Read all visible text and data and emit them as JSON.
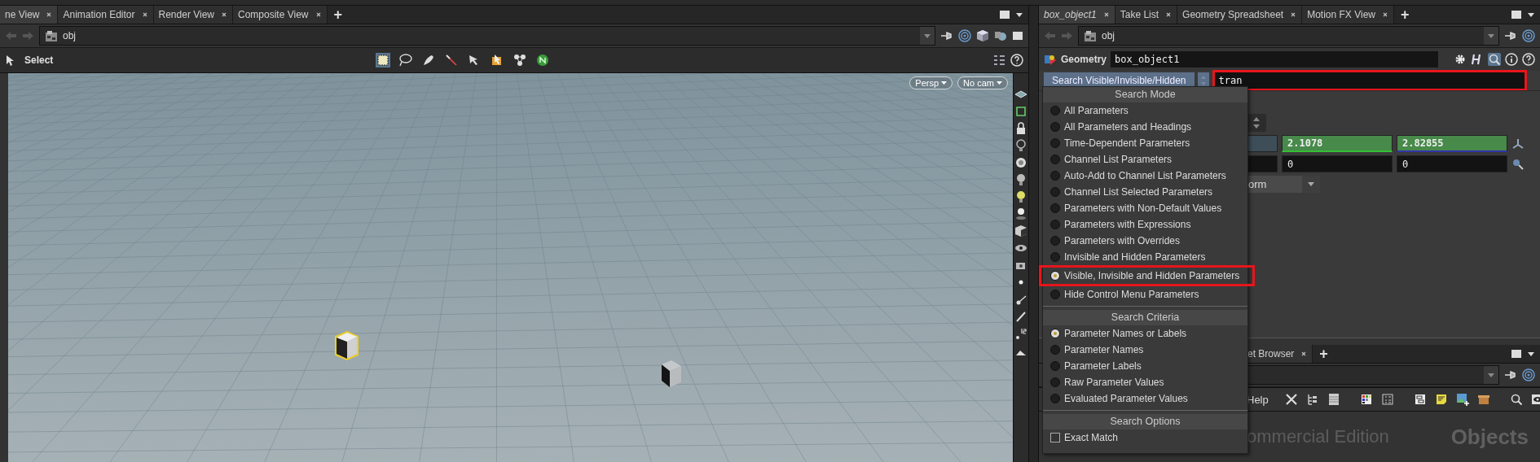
{
  "viewer": {
    "tabs": [
      {
        "label": "ne View",
        "selected": true
      },
      {
        "label": "Animation Editor",
        "selected": false
      },
      {
        "label": "Render View",
        "selected": false
      },
      {
        "label": "Composite View",
        "selected": false
      }
    ],
    "add_tab": "+",
    "path": "obj",
    "tool_label": "Select",
    "camera_buttons": [
      "Persp",
      "No cam"
    ]
  },
  "parameters": {
    "tabs": [
      {
        "label": "box_object1",
        "selected": true
      },
      {
        "label": "Take List",
        "selected": false
      },
      {
        "label": "Geometry Spreadsheet",
        "selected": false
      },
      {
        "label": "Motion FX View",
        "selected": false
      }
    ],
    "add_tab": "+",
    "path": "obj",
    "node_type": "Geometry",
    "node_name": "box_object1",
    "search_mode_button": "Search Visible/Invisible/Hidden",
    "search_field": {
      "value": "tran",
      "highlighted": true
    },
    "field_rows": [
      [
        "2.1078",
        "2.82855"
      ],
      [
        "0",
        "0"
      ]
    ],
    "dropdown": "orm"
  },
  "search_menu": {
    "sections": [
      {
        "title": "Search Mode",
        "kind": "radio",
        "items": [
          {
            "label": "All Parameters",
            "selected": false,
            "highlighted": false
          },
          {
            "label": "All Parameters and Headings",
            "selected": false,
            "highlighted": false
          },
          {
            "label": "Time-Dependent Parameters",
            "selected": false,
            "highlighted": false
          },
          {
            "label": "Channel List Parameters",
            "selected": false,
            "highlighted": false
          },
          {
            "label": "Auto-Add to Channel List Parameters",
            "selected": false,
            "highlighted": false
          },
          {
            "label": "Channel List Selected Parameters",
            "selected": false,
            "highlighted": false
          },
          {
            "label": "Parameters with Non-Default Values",
            "selected": false,
            "highlighted": false
          },
          {
            "label": "Parameters with Expressions",
            "selected": false,
            "highlighted": false
          },
          {
            "label": "Parameters with Overrides",
            "selected": false,
            "highlighted": false
          },
          {
            "label": "Invisible and Hidden Parameters",
            "selected": false,
            "highlighted": false
          },
          {
            "label": "Visible, Invisible and Hidden Parameters",
            "selected": true,
            "highlighted": true
          },
          {
            "label": "Hide Control Menu Parameters",
            "selected": false,
            "highlighted": false
          }
        ]
      },
      {
        "title": "Search Criteria",
        "kind": "radio",
        "items": [
          {
            "label": "Parameter Names or Labels",
            "selected": true,
            "highlighted": false
          },
          {
            "label": "Parameter Names",
            "selected": false,
            "highlighted": false
          },
          {
            "label": "Parameter Labels",
            "selected": false,
            "highlighted": false
          },
          {
            "label": "Raw Parameter Values",
            "selected": false,
            "highlighted": false
          },
          {
            "label": "Evaluated Parameter Values",
            "selected": false,
            "highlighted": false
          }
        ]
      },
      {
        "title": "Search Options",
        "kind": "checkbox",
        "items": [
          {
            "label": "Exact Match",
            "checked": false
          }
        ]
      }
    ]
  },
  "network": {
    "tabs": [
      {
        "label": "et Browser",
        "selected": true
      }
    ],
    "add_tab": "+",
    "help_label": "Help",
    "edition_text": "ommercial Edition",
    "context_label": "Objects"
  }
}
